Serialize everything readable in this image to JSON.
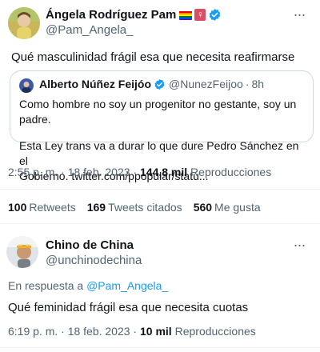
{
  "tweet1": {
    "display_name": "Ángela Rodríguez Pam",
    "handle": "@Pam_Angela_",
    "text": "Qué masculinidad frágil esa que necesita reafirmarse",
    "more_label": "···",
    "badges": [
      "rainbow-flag-icon",
      "venus-symbol-icon",
      "verified-badge-icon"
    ],
    "venus_symbol": "♀",
    "quote": {
      "display_name": "Alberto Núñez Feijóo",
      "handle": "@NunezFeijoo",
      "separator": "·",
      "time": "8h",
      "line1": "Como hombre no soy un progenitor no gestante, soy un padre.",
      "line2": "Esta Ley trans va a durar lo que dure Pedro Sánchez en el",
      "line3": "Gobierno. twitter.com/ppopular/statu..."
    },
    "meta": {
      "timestamp": "2:55 p. m. · 18 feb. 2023 ·",
      "views_count": "144,8 mil",
      "views_label": "Reproducciones"
    },
    "stats": {
      "retweets_count": "100",
      "retweets_label": "Retweets",
      "quotes_count": "169",
      "quotes_label": "Tweets citados",
      "likes_count": "560",
      "likes_label": "Me gusta"
    }
  },
  "tweet2": {
    "display_name": "Chino de China",
    "handle": "@unchinodechina",
    "more_label": "···",
    "reply_prefix": "En respuesta a",
    "reply_handle": "@Pam_Angela_",
    "text": "Qué feminidad frágil esa que necesita cuotas",
    "meta": {
      "timestamp": "6:19 p. m. · 18 feb. 2023 ·",
      "views_count": "10 mil",
      "views_label": "Reproducciones"
    }
  },
  "colors": {
    "accent": "#1d9bf0",
    "secondary_text": "#536471",
    "border": "#cfd9de",
    "divider": "#eff3f4"
  }
}
